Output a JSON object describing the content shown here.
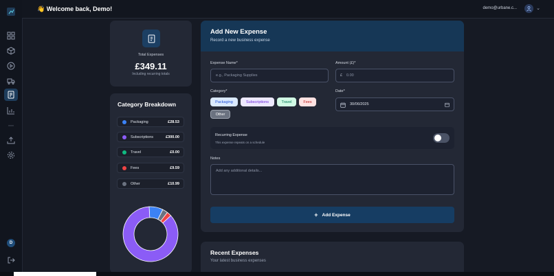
{
  "header": {
    "welcome_emoji": "👋",
    "welcome_text": "Welcome back, Demo!",
    "user_email": "demo@urbane.c...",
    "chevron": "⌄"
  },
  "sidebar": {
    "items": [
      {
        "icon": "logo-icon"
      },
      {
        "icon": "dashboard-icon"
      },
      {
        "icon": "box-icon"
      },
      {
        "icon": "play-icon"
      },
      {
        "icon": "truck-icon"
      },
      {
        "icon": "expenses-icon"
      },
      {
        "icon": "chart-icon"
      },
      {
        "icon": "upload-icon"
      },
      {
        "icon": "settings-icon"
      }
    ],
    "avatar_letter": "D"
  },
  "total": {
    "label": "Total Expenses",
    "value": "£349.11",
    "note": "Including recurring totals"
  },
  "breakdown": {
    "title": "Category Breakdown",
    "rows": [
      {
        "name": "Packaging",
        "amount": "£28.53",
        "color": "#3b82f6",
        "value": 28.53
      },
      {
        "name": "Subscriptions",
        "amount": "£300.00",
        "color": "#8b5cf6",
        "value": 300.0
      },
      {
        "name": "Travel",
        "amount": "£0.00",
        "color": "#10b981",
        "value": 0.0
      },
      {
        "name": "Fees",
        "amount": "£9.59",
        "color": "#ef4444",
        "value": 9.59
      },
      {
        "name": "Other",
        "amount": "£10.99",
        "color": "#6b7280",
        "value": 10.99
      }
    ]
  },
  "form": {
    "title": "Add New Expense",
    "subtitle": "Record a new business expense",
    "name_label": "Expense Name*",
    "name_placeholder": "e.g., Packaging Supplies",
    "amount_label": "Amount (£)*",
    "currency_symbol": "£",
    "amount_placeholder": "0.00",
    "category_label": "Category*",
    "categories": [
      "Packaging",
      "Subscriptions",
      "Travel",
      "Fees",
      "Other"
    ],
    "selected_category": "Other",
    "date_label": "Date*",
    "date_value": "30/06/2025",
    "recurring_title": "Recurring Expense",
    "recurring_desc": "This expense repeats on a schedule",
    "recurring_on": false,
    "notes_label": "Notes",
    "notes_placeholder": "Add any additional details...",
    "submit_label": "Add Expense"
  },
  "recent": {
    "title": "Recent Expenses",
    "subtitle": "Your latest business expenses"
  }
}
